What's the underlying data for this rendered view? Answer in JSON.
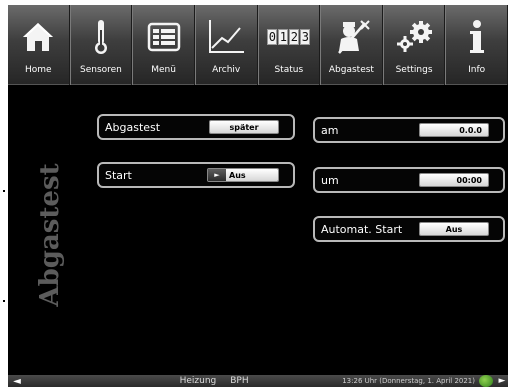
{
  "toolbar": {
    "items": [
      {
        "label": "Home",
        "icon": "home-icon"
      },
      {
        "label": "Sensoren",
        "icon": "thermometer-icon"
      },
      {
        "label": "Menü",
        "icon": "menu-list-icon"
      },
      {
        "label": "Archiv",
        "icon": "chart-line-icon"
      },
      {
        "label": "Status",
        "icon": "counter-icon",
        "digits": [
          "0",
          "1",
          "2",
          "3"
        ]
      },
      {
        "label": "Abgastest",
        "icon": "chimney-sweep-icon"
      },
      {
        "label": "Settings",
        "icon": "gears-icon"
      },
      {
        "label": "Info",
        "icon": "info-icon"
      }
    ]
  },
  "page": {
    "title": "Abgastest"
  },
  "settings": {
    "abgastest": {
      "label": "Abgastest",
      "value": "später"
    },
    "start": {
      "label": "Start",
      "value": "Aus",
      "arrow": "►"
    },
    "am": {
      "label": "am",
      "value": "0.0.0"
    },
    "um": {
      "label": "um",
      "value": "00:00"
    },
    "automat_start": {
      "label": "Automat. Start",
      "value": "Aus"
    }
  },
  "statusbar": {
    "left_arrow": "◄",
    "right_arrow": "►",
    "mode": "Heizung",
    "device": "BPH",
    "datetime": "13:26 Uhr (Donnerstag, 1. April 2021)"
  },
  "colors": {
    "background": "#000000",
    "toolbar_top": "#6b6b6b",
    "toolbar_bottom": "#262626",
    "box_border": "#b9b9b9",
    "title_gray": "#5c5c5c",
    "globe_green": "#5fb832"
  }
}
